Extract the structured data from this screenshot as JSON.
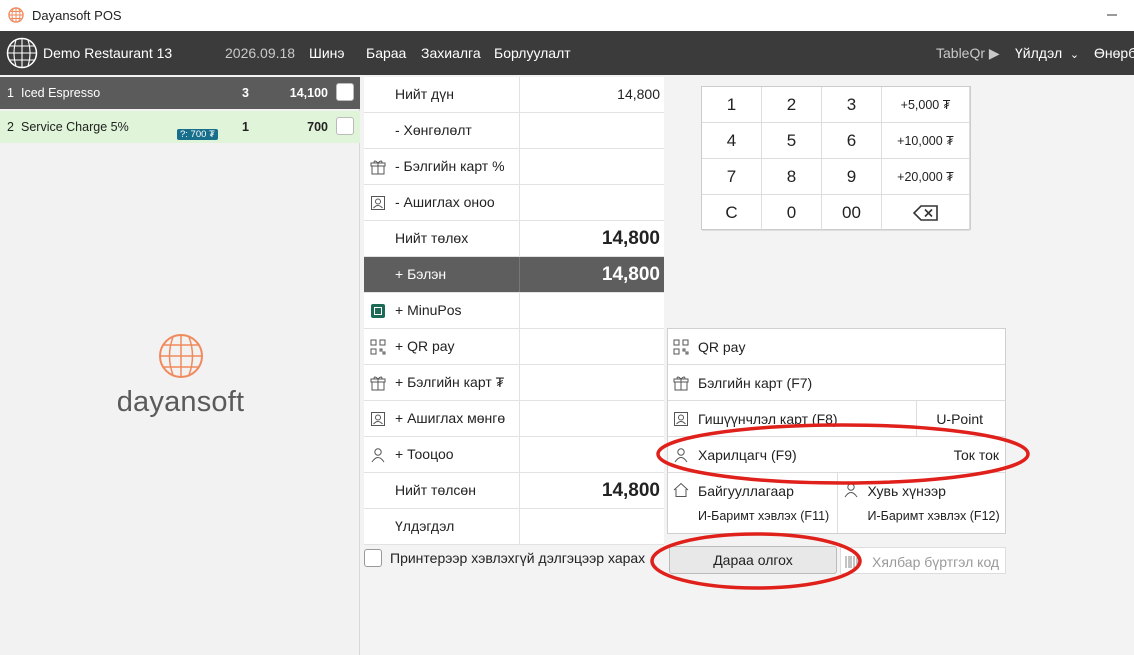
{
  "window": {
    "title": "Dayansoft POS",
    "app_icon": "globe-logo-icon"
  },
  "topbar": {
    "restaurant": "Demo Restaurant 13",
    "date": "2026.09.18",
    "new": "Шинэ",
    "menu": [
      "Бараа",
      "Захиалга",
      "Борлуулалт"
    ],
    "tableqr": "TableQr",
    "action": "Үйлдэл",
    "cut": "Өнөрб"
  },
  "order_items": [
    {
      "no": "1",
      "name": "Iced Espresso",
      "qty": "3",
      "amount": "14,100",
      "badge": ""
    },
    {
      "no": "2",
      "name": "Service Charge 5%",
      "qty": "1",
      "amount": "700",
      "badge": "?: 700 ₮"
    }
  ],
  "brand": {
    "word": "dayansoft",
    "accent": "#f08a5d"
  },
  "totals": [
    {
      "label": "Нийт дүн",
      "value": "14,800",
      "icon": ""
    },
    {
      "label": "- Хөнгөлөлт",
      "value": "",
      "icon": ""
    },
    {
      "label": "- Бэлгийн карт %",
      "value": "",
      "icon": "gift-icon"
    },
    {
      "label": "- Ашиглах оноо",
      "value": "",
      "icon": "member-card-icon"
    },
    {
      "label": "Нийт төлөх",
      "value": "14,800",
      "icon": ""
    },
    {
      "label": "+ Бэлэн",
      "value": "14,800",
      "icon": ""
    },
    {
      "label": "+ MinuPos",
      "value": "",
      "icon": "minupos-icon"
    },
    {
      "label": "+ QR pay",
      "value": "",
      "icon": "qr-icon"
    },
    {
      "label": "+ Бэлгийн карт ₮",
      "value": "",
      "icon": "gift-icon"
    },
    {
      "label": "+ Ашиглах мөнгө",
      "value": "",
      "icon": "member-card-icon"
    },
    {
      "label": "+ Тооцоо",
      "value": "",
      "icon": "person-icon"
    },
    {
      "label": "Нийт төлсөн",
      "value": "14,800",
      "icon": ""
    },
    {
      "label": "Үлдэгдэл",
      "value": "",
      "icon": ""
    }
  ],
  "print_option": "Принтерээр хэвлэхгүй дэлгэцээр харах",
  "keypad": [
    "1",
    "2",
    "3",
    "+5,000 ₮",
    "4",
    "5",
    "6",
    "+10,000 ₮",
    "7",
    "8",
    "9",
    "+20,000 ₮",
    "C",
    "0",
    "00",
    ""
  ],
  "payment": {
    "qr": "QR pay",
    "gift": "Бэлгийн карт (F7)",
    "member": "Гишүүнчлэл карт (F8)",
    "upoint": "U-Point",
    "customer": "Харилцагч (F9)",
    "customer_value": "Ток ток",
    "org": "Байгууллагаар",
    "org_sub": "И-Баримт хэвлэх (F11)",
    "person": "Хувь хүнээр",
    "person_sub": "И-Баримт хэвлэх (F12)"
  },
  "later_button": "Дараа олгох",
  "easy_code": "Хялбар бүртгэл код",
  "annotation_color": "#e0201b"
}
